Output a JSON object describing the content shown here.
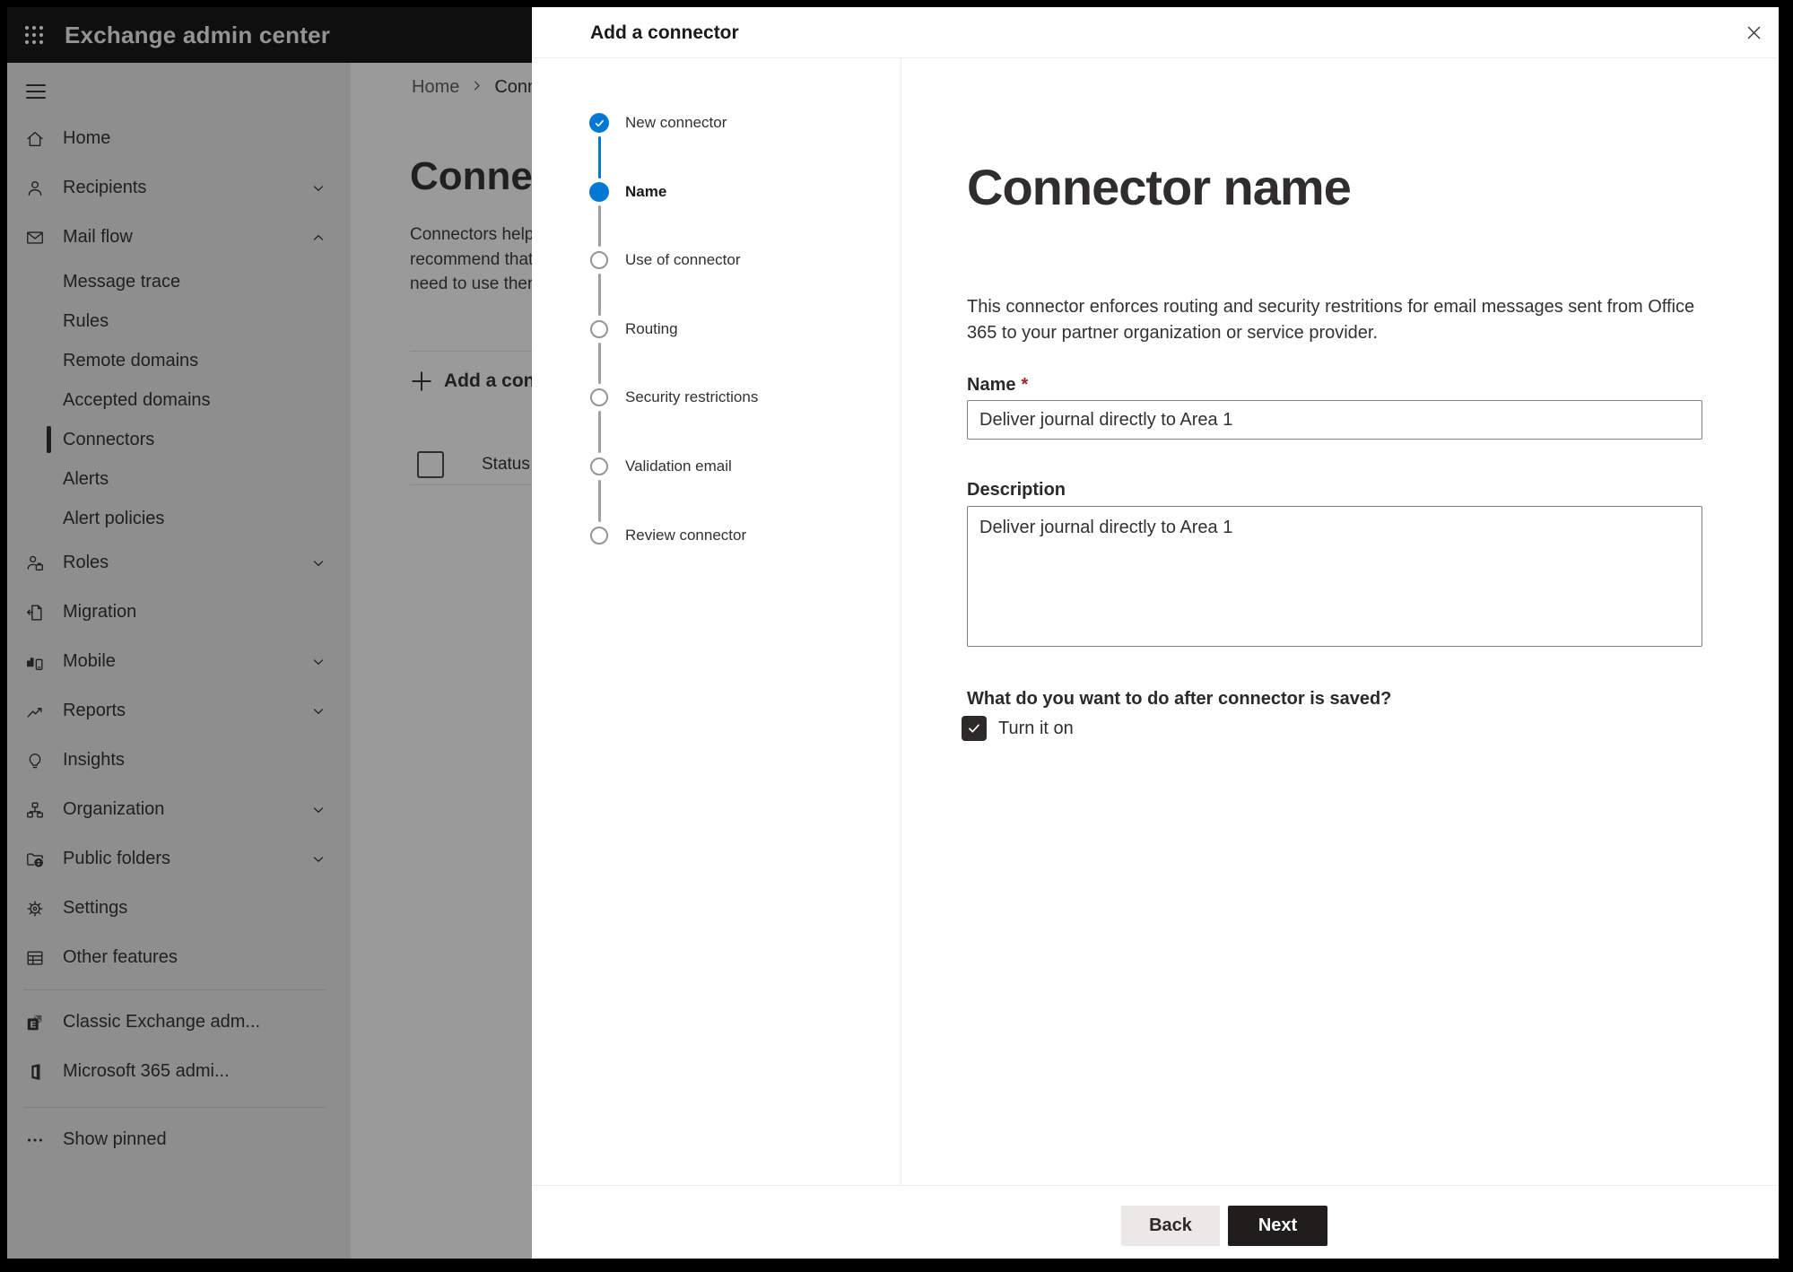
{
  "topbar": {
    "title": "Exchange admin center",
    "app_launcher_icon": "waffle-icon"
  },
  "sidebar": {
    "items": [
      {
        "label": "Home",
        "icon": "home-icon"
      },
      {
        "label": "Recipients",
        "icon": "person-icon",
        "chevron": "down"
      },
      {
        "label": "Mail flow",
        "icon": "mail-icon",
        "chevron": "up"
      },
      {
        "label": "Message trace",
        "indent": true
      },
      {
        "label": "Rules",
        "indent": true
      },
      {
        "label": "Remote domains",
        "indent": true
      },
      {
        "label": "Accepted domains",
        "indent": true
      },
      {
        "label": "Connectors",
        "indent": true,
        "selected": true
      },
      {
        "label": "Alerts",
        "indent": true
      },
      {
        "label": "Alert policies",
        "indent": true
      },
      {
        "label": "Roles",
        "icon": "roles-icon",
        "chevron": "down"
      },
      {
        "label": "Migration",
        "icon": "migration-icon"
      },
      {
        "label": "Mobile",
        "icon": "mobile-icon",
        "chevron": "down"
      },
      {
        "label": "Reports",
        "icon": "reports-icon",
        "chevron": "down"
      },
      {
        "label": "Insights",
        "icon": "insights-icon"
      },
      {
        "label": "Organization",
        "icon": "organization-icon",
        "chevron": "down"
      },
      {
        "label": "Public folders",
        "icon": "public-folders-icon",
        "chevron": "down"
      },
      {
        "label": "Settings",
        "icon": "settings-icon"
      },
      {
        "label": "Other features",
        "icon": "other-features-icon"
      },
      {
        "divider": true
      },
      {
        "label": "Classic Exchange adm...",
        "icon": "exchange-icon"
      },
      {
        "label": "Microsoft 365 admi...",
        "icon": "office-icon"
      },
      {
        "divider": true,
        "gap": true
      },
      {
        "label": "Show pinned",
        "icon": "ellipsis-icon"
      }
    ]
  },
  "background": {
    "breadcrumb": {
      "home": "Home",
      "current": "Conne"
    },
    "page_title": "Connec",
    "description_lines": [
      "Connectors help",
      "recommend that",
      "need to use ther"
    ],
    "add_button_label": "Add a conn",
    "table": {
      "status_header": "Status"
    }
  },
  "dialog": {
    "title": "Add a connector",
    "steps": [
      {
        "label": "New connector",
        "state": "completed"
      },
      {
        "label": "Name",
        "state": "current"
      },
      {
        "label": "Use of connector",
        "state": "upcoming"
      },
      {
        "label": "Routing",
        "state": "upcoming"
      },
      {
        "label": "Security restrictions",
        "state": "upcoming"
      },
      {
        "label": "Validation email",
        "state": "upcoming"
      },
      {
        "label": "Review connector",
        "state": "upcoming"
      }
    ],
    "content": {
      "heading": "Connector name",
      "description": "This connector enforces routing and security restritions for email messages sent from Office 365 to your partner organization or service provider.",
      "name_label": "Name",
      "required_marker": "*",
      "name_value": "Deliver journal directly to Area 1",
      "description_label": "Description",
      "description_value": "Deliver journal directly to Area 1",
      "after_save_question": "What do you want to do after connector is saved?",
      "turn_on_label": "Turn it on",
      "turn_on_checked": true
    },
    "footer": {
      "back_label": "Back",
      "next_label": "Next"
    }
  },
  "colors": {
    "accent": "#0078d4",
    "topbar_bg": "#151413",
    "next_button_bg": "#1f1e1d",
    "back_button_bg": "#ebe9e7",
    "required_red": "#a4262c"
  }
}
